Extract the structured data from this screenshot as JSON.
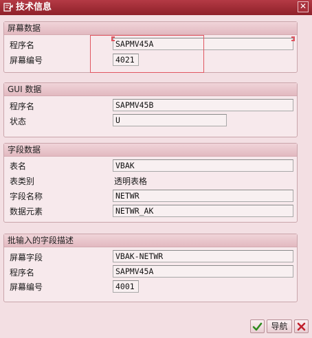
{
  "window": {
    "title": "技术信息",
    "close_label": "✕"
  },
  "screen_data": {
    "header": "屏幕数据",
    "program_label": "程序名",
    "program_value": "SAPMV45A",
    "screen_no_label": "屏幕编号",
    "screen_no_value": "4021"
  },
  "gui_data": {
    "header": "GUI 数据",
    "program_label": "程序名",
    "program_value": "SAPMV45B",
    "status_label": "状态",
    "status_value": "U"
  },
  "field_data": {
    "header": "字段数据",
    "table_label": "表名",
    "table_value": "VBAK",
    "table_type_label": "表类别",
    "table_type_value": "透明表格",
    "field_name_label": "字段名称",
    "field_name_value": "NETWR",
    "data_element_label": "数据元素",
    "data_element_value": "NETWR_AK"
  },
  "batch_input": {
    "header": "批输入的字段描述",
    "screen_field_label": "屏幕字段",
    "screen_field_value": "VBAK-NETWR",
    "program_label": "程序名",
    "program_value": "SAPMV45A",
    "screen_no_label": "屏幕编号",
    "screen_no_value": "4001"
  },
  "footer": {
    "ok_icon": "checkmark-icon",
    "nav_label": "导航",
    "cancel_icon": "close-icon",
    "colors": {
      "ok": "#2e8b1f",
      "cancel": "#c0202c"
    }
  }
}
